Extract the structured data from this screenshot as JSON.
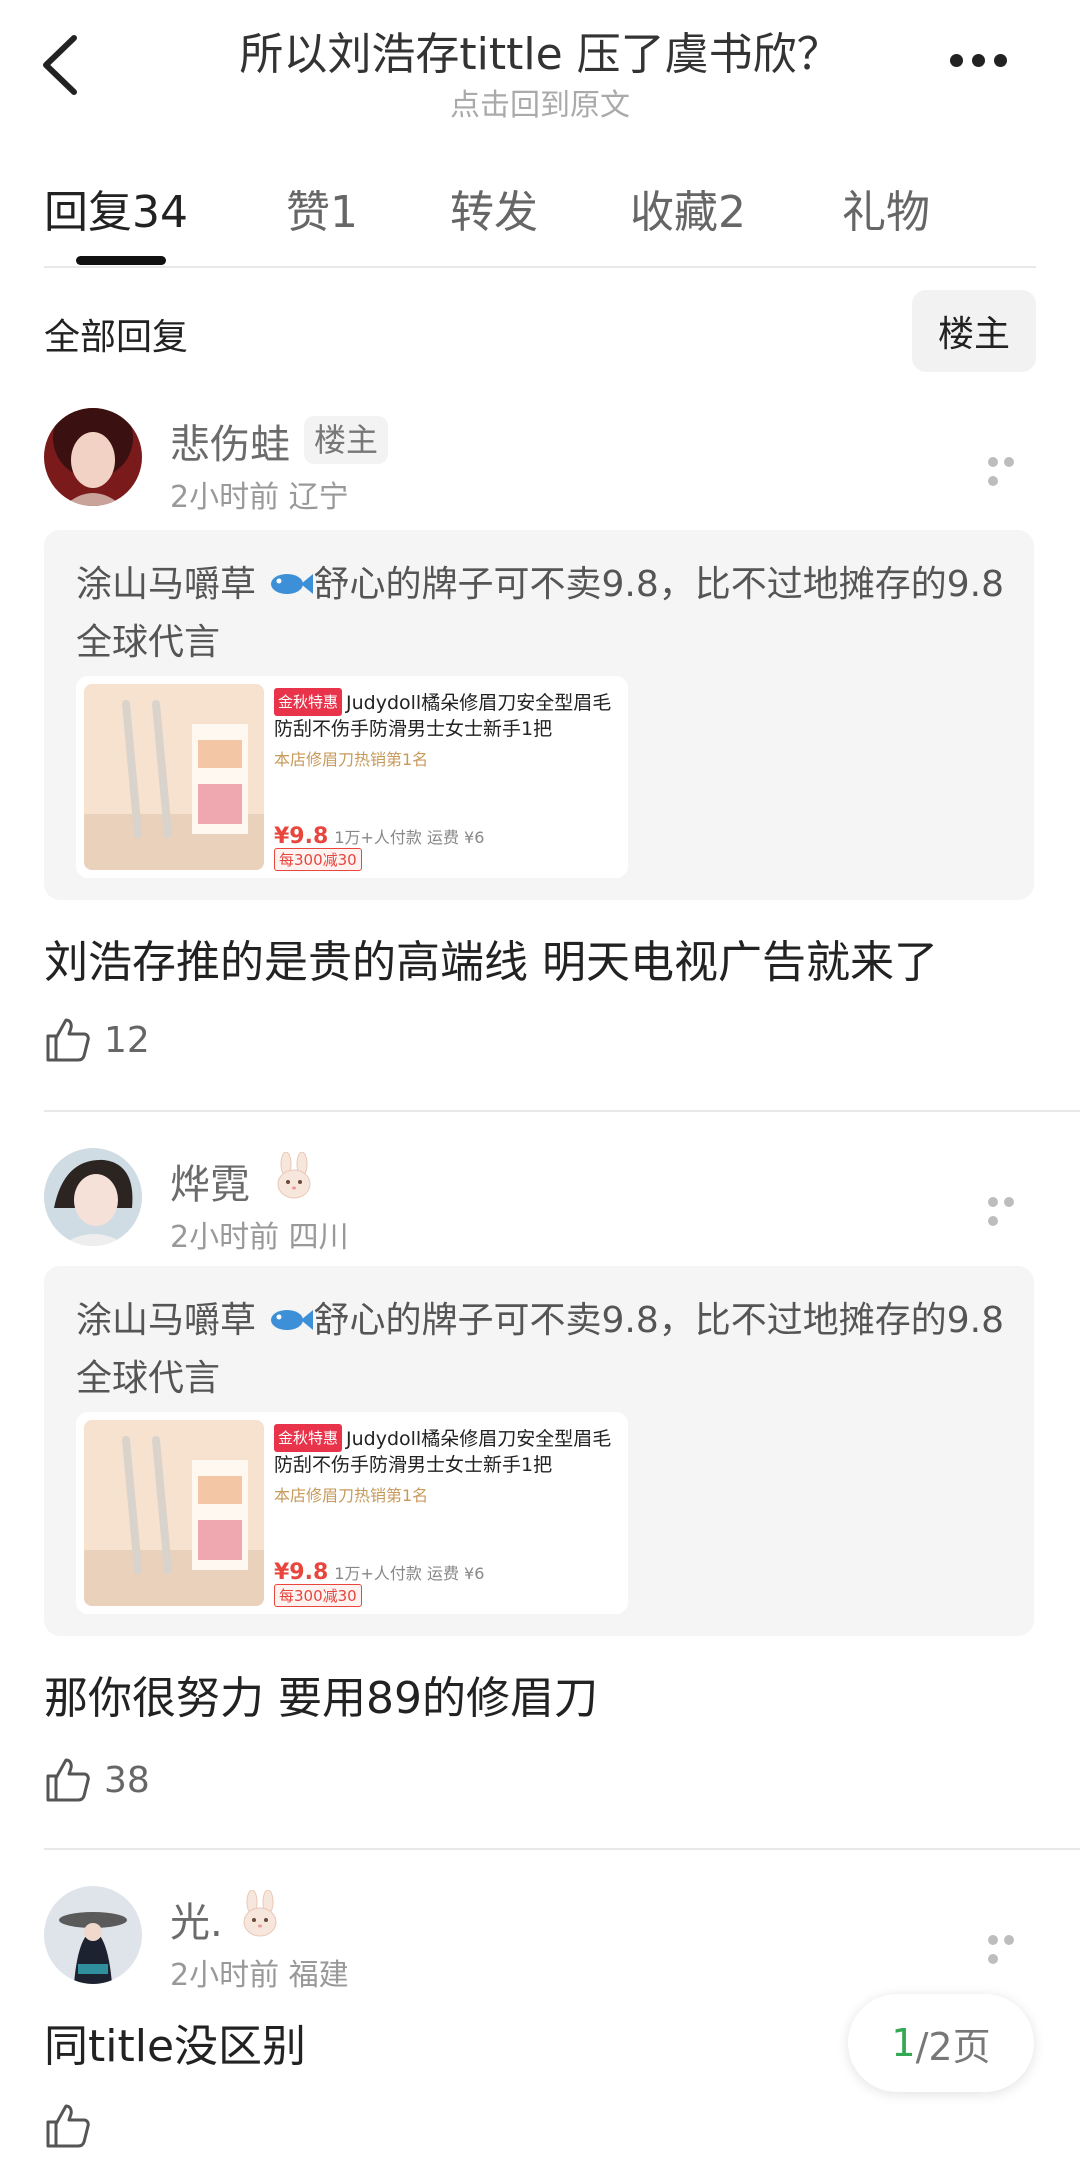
{
  "header": {
    "title": "所以刘浩存tittle 压了虞书欣？",
    "subtitle": "点击回到原文"
  },
  "tabs": [
    {
      "label": "回复",
      "count": "34"
    },
    {
      "label": "赞",
      "count": "1"
    },
    {
      "label": "转发",
      "count": ""
    },
    {
      "label": "收藏",
      "count": "2"
    },
    {
      "label": "礼物",
      "count": ""
    }
  ],
  "section": {
    "title": "全部回复",
    "filter_label": "楼主"
  },
  "comments": [
    {
      "username": "悲伤蛙",
      "badge": "楼主",
      "time": "2小时前",
      "location": "辽宁",
      "quote": {
        "author": "涂山马嚼草",
        "text": "舒心的牌子可不卖9.8，比不过地摊存的9.8全球代言",
        "product": {
          "tag": "金秋特惠",
          "title": "Judydoll橘朵修眉刀安全型眉毛防刮不伤手防滑男士女士新手1把",
          "rank": "本店修眉刀热销第1名",
          "price": "¥9.8",
          "sales": "1万+人付款",
          "shipping": "运费 ¥6",
          "discount": "每300减30"
        }
      },
      "body": "刘浩存推的是贵的高端线 明天电视广告就来了",
      "likes": "12"
    },
    {
      "username": "烨霓",
      "time": "2小时前",
      "location": "四川",
      "quote": {
        "author": "涂山马嚼草",
        "text": "舒心的牌子可不卖9.8，比不过地摊存的9.8全球代言",
        "product": {
          "tag": "金秋特惠",
          "title": "Judydoll橘朵修眉刀安全型眉毛防刮不伤手防滑男士女士新手1把",
          "rank": "本店修眉刀热销第1名",
          "price": "¥9.8",
          "sales": "1万+人付款",
          "shipping": "运费 ¥6",
          "discount": "每300减30"
        }
      },
      "body": "那你很努力 要用89的修眉刀",
      "likes": "38"
    },
    {
      "username": "光.",
      "time": "2小时前",
      "location": "福建",
      "body": "同title没区别",
      "likes": ""
    }
  ],
  "pager": {
    "current": "1",
    "total": "/2页"
  },
  "colors": {
    "accent_green": "#34a853",
    "price_red": "#e8453c",
    "text_primary": "#222222",
    "text_secondary": "#999999"
  }
}
